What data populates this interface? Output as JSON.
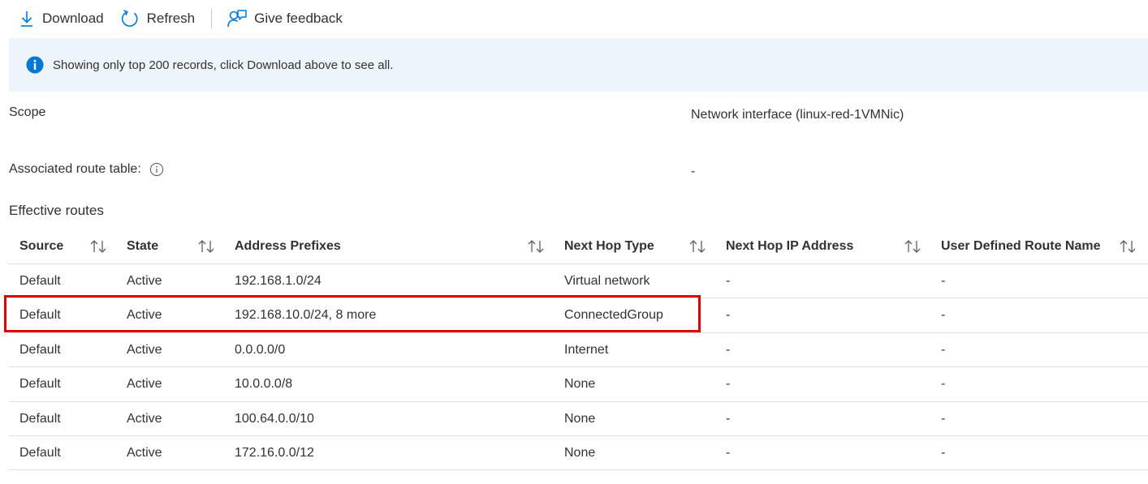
{
  "toolbar": {
    "download_label": "Download",
    "refresh_label": "Refresh",
    "feedback_label": "Give feedback"
  },
  "banner": {
    "message": "Showing only top 200 records, click Download above to see all."
  },
  "scope": {
    "label": "Scope",
    "value": "Network interface (linux-red-1VMNic)"
  },
  "route_table": {
    "label": "Associated route table:",
    "value": "-"
  },
  "routes": {
    "title": "Effective routes",
    "columns": [
      "Source",
      "State",
      "Address Prefixes",
      "Next Hop Type",
      "Next Hop IP Address",
      "User Defined Route Name"
    ],
    "rows": [
      [
        "Default",
        "Active",
        "192.168.1.0/24",
        "Virtual network",
        "-",
        "-"
      ],
      [
        "Default",
        "Active",
        "192.168.10.0/24, 8 more",
        "ConnectedGroup",
        "-",
        "-"
      ],
      [
        "Default",
        "Active",
        "0.0.0.0/0",
        "Internet",
        "-",
        "-"
      ],
      [
        "Default",
        "Active",
        "10.0.0.0/8",
        "None",
        "-",
        "-"
      ],
      [
        "Default",
        "Active",
        "100.64.0.0/10",
        "None",
        "-",
        "-"
      ],
      [
        "Default",
        "Active",
        "172.16.0.0/12",
        "None",
        "-",
        "-"
      ]
    ],
    "highlighted_row": 1
  },
  "colors": {
    "accent": "#0078d4",
    "banner_bg": "#eef4fc",
    "highlight": "#e00000",
    "text": "#323130",
    "divider": "#e1dfdd"
  },
  "icons": {
    "download": "download-icon",
    "refresh": "refresh-icon",
    "feedback": "feedback-icon",
    "info": "info-icon",
    "sort": "sort-icon"
  }
}
